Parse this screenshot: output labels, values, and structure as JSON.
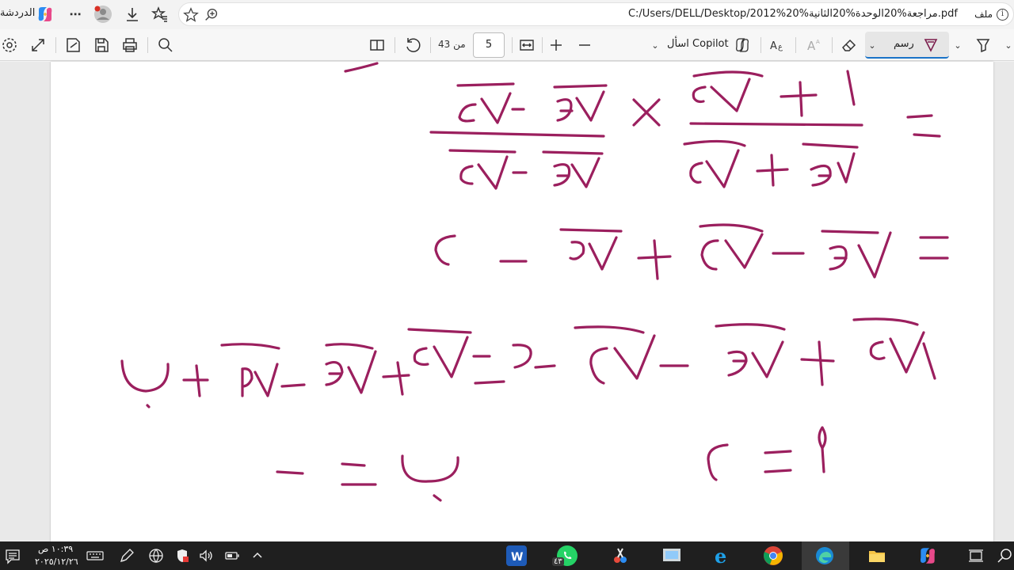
{
  "browser": {
    "chat_label": "الدردشة",
    "url": "C:/Users/DELL/Desktop/2012%مراجعة%20الوحدة%20الثانية%20.pdf",
    "file_label": "ملف",
    "info_symbol": "i",
    "icons": [
      "copilot-logo",
      "more-icon",
      "profile-icon",
      "download-icon",
      "favorites-icon",
      "add-favorite-icon",
      "zoom-icon",
      "info-icon"
    ]
  },
  "pdf_toolbar": {
    "current_page": "5",
    "of_label": "من 43",
    "ask_copilot": "اسأل Copilot",
    "draw_label": "رسم",
    "icons": [
      "settings-icon",
      "fullscreen-icon",
      "save-as-icon",
      "save-icon",
      "print-icon",
      "search-icon",
      "page-view-icon",
      "rotate-icon",
      "fit-width-icon",
      "zoom-in-icon",
      "zoom-out-icon",
      "copilot-icon",
      "read-aloud-icon",
      "text-icon",
      "eraser-icon",
      "draw-icon",
      "highlight-icon"
    ]
  },
  "colors": {
    "ink": "#9b1f5e",
    "accent": "#1a73c8"
  },
  "taskbar": {
    "time": "١٠:٣٩ ص",
    "date": "٢٠٢٥/١٢/٢٦",
    "whatsapp_badge": "٤٣",
    "apps": [
      "word",
      "whatsapp",
      "snip",
      "monitor",
      "ie",
      "chrome",
      "edge",
      "explorer",
      "copilot",
      "taskview",
      "search"
    ]
  }
}
